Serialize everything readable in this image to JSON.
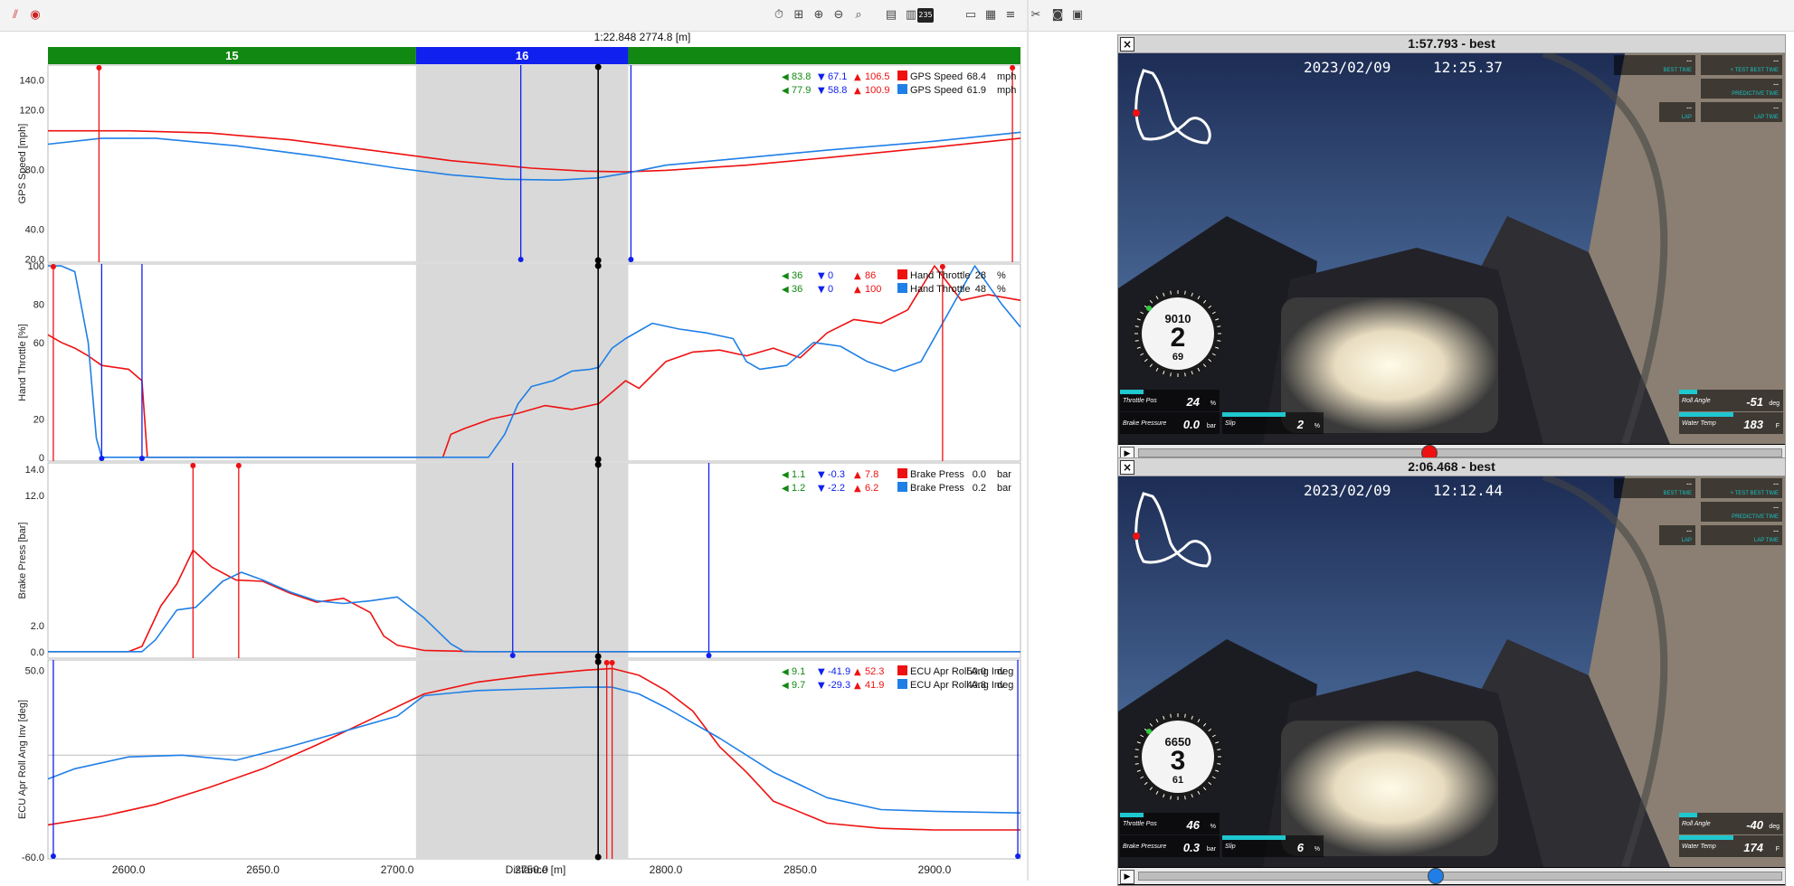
{
  "cursor_readout": "1:22.848  2774.8 [m]",
  "toolbar": {
    "badge_label": "235"
  },
  "colors": {
    "lap_red": "#ee1111",
    "lap_blue": "#1f7fe6",
    "sector_green": "#118811",
    "sector_blue": "#1020ee",
    "highlight_gray": "#d9d9d9",
    "hud_cyan": "#1fc7cf"
  },
  "sectors": [
    {
      "label": "15",
      "start": 2570,
      "end": 2707,
      "color": "#118811"
    },
    {
      "label": "16",
      "start": 2707,
      "end": 2786,
      "color": "#1020ee"
    },
    {
      "label": "",
      "start": 2786,
      "end": 2932,
      "color": "#118811"
    }
  ],
  "highlight": {
    "start": 2707,
    "end": 2786
  },
  "cursor_distance": 2774.8,
  "chart_data": {
    "type": "line",
    "xlabel": "Distance [m]",
    "xlim": [
      2570,
      2932
    ],
    "xticks": [
      2600,
      2650,
      2700,
      2750,
      2800,
      2850,
      2900
    ],
    "xtick_labels": [
      "2600.0",
      "2650.0",
      "2700.0",
      "2750.0",
      "2800.0",
      "2850.0",
      "2900.0"
    ],
    "panels": [
      {
        "ylabel": "GPS Speed [mph]",
        "ylim": [
          18,
          150
        ],
        "yticks": [
          20,
          40,
          80,
          120,
          140
        ],
        "ytick_labels": [
          "20.0",
          "40.0",
          "80.0",
          "120.0",
          "140.0"
        ],
        "series": [
          {
            "name": "GPS Speed",
            "color": "#ee1111",
            "x": [
              2570,
              2600,
              2630,
              2660,
              2690,
              2720,
              2750,
              2770,
              2785,
              2800,
              2830,
              2860,
              2900,
              2932
            ],
            "y": [
              106,
              106,
              104.5,
              100,
              93,
              86,
              81,
              79,
              78.5,
              79.5,
              83,
              88,
              95,
              101
            ]
          },
          {
            "name": "GPS Speed",
            "color": "#1f7fe6",
            "x": [
              2570,
              2590,
              2610,
              2640,
              2670,
              2700,
              2720,
              2740,
              2760,
              2775,
              2785,
              2800,
              2830,
              2860,
              2900,
              2932
            ],
            "y": [
              97,
              101,
              101,
              96,
              89,
              81,
              76.5,
              73.5,
              73,
              74.5,
              77.5,
              83,
              88,
              93,
              99,
              105
            ]
          }
        ],
        "legend": [
          {
            "min": "83.8",
            "mean": "67.1",
            "max": "106.5",
            "name": "GPS Speed",
            "value": "68.4",
            "unit": "mph",
            "color": "#ee1111"
          },
          {
            "min": "77.9",
            "mean": "58.8",
            "max": "100.9",
            "name": "GPS Speed",
            "value": "61.9",
            "unit": "mph",
            "color": "#1f7fe6"
          }
        ],
        "markers": [
          {
            "x": 2589,
            "color": "#ee1111",
            "cap": "top"
          },
          {
            "x": 2929,
            "color": "#ee1111",
            "cap": "top"
          },
          {
            "x": 2746,
            "color": "#1020ee",
            "cap": "bottom"
          },
          {
            "x": 2787,
            "color": "#1020ee",
            "cap": "bottom"
          }
        ]
      },
      {
        "ylabel": "Hand Throttle [%]",
        "ylim": [
          -2,
          101
        ],
        "yticks": [
          0,
          20,
          60,
          80,
          100
        ],
        "ytick_labels": [
          "0",
          "20",
          "60",
          "80",
          "100"
        ],
        "series": [
          {
            "name": "Hand Throttle",
            "color": "#ee1111",
            "x": [
              2570,
              2575,
              2580,
              2585,
              2590,
              2600,
              2605,
              2607,
              2609,
              2650,
              2700,
              2717,
              2720,
              2725,
              2735,
              2745,
              2755,
              2765,
              2775,
              2785,
              2790,
              2800,
              2810,
              2820,
              2830,
              2840,
              2850,
              2860,
              2870,
              2880,
              2890,
              2900,
              2910,
              2920,
              2932
            ],
            "y": [
              64,
              60,
              57,
              53,
              48,
              46,
              40,
              0,
              0,
              0,
              0,
              0,
              12,
              15,
              20,
              23,
              27,
              25,
              28,
              40,
              36,
              50,
              55,
              56,
              53,
              57,
              52,
              65,
              72,
              70,
              77,
              100,
              82,
              85,
              82
            ]
          },
          {
            "name": "Hand Throttle",
            "color": "#1f7fe6",
            "x": [
              2570,
              2575,
              2580,
              2585,
              2588,
              2590,
              2650,
              2700,
              2734,
              2740,
              2745,
              2750,
              2758,
              2765,
              2772,
              2775,
              2780,
              2785,
              2795,
              2805,
              2815,
              2825,
              2830,
              2835,
              2845,
              2855,
              2865,
              2875,
              2885,
              2895,
              2905,
              2915,
              2925,
              2932
            ],
            "y": [
              100,
              100,
              97,
              60,
              10,
              0,
              0,
              0,
              0,
              12,
              28,
              37,
              40,
              45,
              46,
              47,
              57,
              62,
              70,
              67,
              65,
              62,
              50,
              46,
              48,
              60,
              58,
              50,
              45,
              50,
              75,
              100,
              80,
              68
            ]
          }
        ],
        "legend": [
          {
            "min": "36",
            "mean": "0",
            "max": "86",
            "name": "Hand Throttle",
            "value": "28",
            "unit": "%",
            "color": "#ee1111"
          },
          {
            "min": "36",
            "mean": "0",
            "max": "100",
            "name": "Hand Throttle",
            "value": "48",
            "unit": "%",
            "color": "#1f7fe6"
          }
        ],
        "markers": [
          {
            "x": 2572,
            "color": "#ee1111",
            "cap": "top"
          },
          {
            "x": 2903,
            "color": "#ee1111",
            "cap": "top"
          },
          {
            "x": 2590,
            "color": "#1020ee",
            "cap": "bottom"
          },
          {
            "x": 2605,
            "color": "#1020ee",
            "cap": "bottom"
          }
        ]
      },
      {
        "ylabel": "Brake Press [bar]",
        "ylim": [
          -0.5,
          14.5
        ],
        "yticks": [
          0,
          2,
          12,
          14
        ],
        "ytick_labels": [
          "0.0",
          "2.0",
          "12.0",
          "14.0"
        ],
        "series": [
          {
            "name": "Brake Press",
            "color": "#ee1111",
            "x": [
              2570,
              2600,
              2605,
              2612,
              2618,
              2624,
              2631,
              2640,
              2650,
              2660,
              2670,
              2680,
              2690,
              2695,
              2700,
              2710,
              2730,
              2760,
              2800,
              2850,
              2932
            ],
            "y": [
              0,
              0,
              0.4,
              3.5,
              5.2,
              7.8,
              6.5,
              5.5,
              5.4,
              4.5,
              3.8,
              4.1,
              3,
              1.2,
              0.5,
              0.1,
              0,
              0,
              0,
              0,
              0
            ]
          },
          {
            "name": "Brake Press",
            "color": "#1f7fe6",
            "x": [
              2570,
              2605,
              2610,
              2618,
              2625,
              2635,
              2642,
              2650,
              2660,
              2670,
              2680,
              2690,
              2700,
              2710,
              2720,
              2725,
              2735,
              2760,
              2800,
              2850,
              2932
            ],
            "y": [
              0,
              0,
              0.9,
              3.2,
              3.4,
              5.4,
              6.1,
              5.5,
              4.6,
              3.9,
              3.7,
              3.9,
              4.2,
              2.6,
              0.6,
              0,
              0,
              0,
              0,
              0,
              0
            ]
          }
        ],
        "legend": [
          {
            "min": "1.1",
            "mean": "-0.3",
            "max": "7.8",
            "name": "Brake Press",
            "value": "0.0",
            "unit": "bar",
            "color": "#ee1111"
          },
          {
            "min": "1.2",
            "mean": "-2.2",
            "max": "6.2",
            "name": "Brake Press",
            "value": "0.2",
            "unit": "bar",
            "color": "#1f7fe6"
          }
        ],
        "markers": [
          {
            "x": 2624,
            "color": "#ee1111",
            "cap": "top"
          },
          {
            "x": 2641,
            "color": "#ee1111",
            "cap": "top"
          },
          {
            "x": 2743,
            "color": "#1020ee",
            "cap": "bottom"
          },
          {
            "x": 2816,
            "color": "#1020ee",
            "cap": "bottom"
          }
        ]
      },
      {
        "ylabel": "ECU Apr Roll Ang Inv [deg]",
        "ylim": [
          -61,
          56
        ],
        "yticks": [
          -60,
          50
        ],
        "ytick_labels": [
          "-60.0",
          "50.0"
        ],
        "zero_line": 0,
        "series": [
          {
            "name": "ECU Apr Roll Ang Inv",
            "color": "#ee1111",
            "x": [
              2570,
              2590,
              2610,
              2630,
              2650,
              2670,
              2690,
              2710,
              2730,
              2750,
              2770,
              2780,
              2790,
              2800,
              2810,
              2820,
              2830,
              2840,
              2860,
              2880,
              2900,
              2932
            ],
            "y": [
              -41,
              -36,
              -29,
              -19,
              -8,
              6,
              21,
              36,
              43,
              47,
              50,
              51,
              47,
              38,
              26,
              5,
              -10,
              -27,
              -40,
              -43,
              -44,
              -44
            ]
          },
          {
            "name": "ECU Apr Roll Ang Inv",
            "color": "#1f7fe6",
            "x": [
              2570,
              2580,
              2600,
              2620,
              2640,
              2660,
              2680,
              2700,
              2710,
              2730,
              2750,
              2770,
              2780,
              2790,
              2800,
              2820,
              2840,
              2860,
              2880,
              2900,
              2932
            ],
            "y": [
              -14,
              -8,
              -1,
              0,
              -3,
              5,
              14,
              23,
              35,
              38,
              39,
              40,
              40,
              36,
              28,
              10,
              -10,
              -25,
              -32,
              -33,
              -34
            ]
          }
        ],
        "legend": [
          {
            "min": "9.1",
            "mean": "-41.9",
            "max": "52.3",
            "name": "ECU Apr Roll Ang Inv",
            "value": "50.0",
            "unit": "deg",
            "color": "#ee1111"
          },
          {
            "min": "9.7",
            "mean": "-29.3",
            "max": "41.9",
            "name": "ECU Apr Roll Ang Inv",
            "value": "40.8",
            "unit": "deg",
            "color": "#1f7fe6"
          }
        ],
        "markers": [
          {
            "x": 2778,
            "color": "#ee1111",
            "cap": "top"
          },
          {
            "x": 2780,
            "color": "#ee1111",
            "cap": "top"
          },
          {
            "x": 2572,
            "color": "#1020ee",
            "cap": "bottom"
          },
          {
            "x": 2931,
            "color": "#1020ee",
            "cap": "bottom"
          }
        ]
      }
    ]
  },
  "videos": [
    {
      "title": "1:57.793 - best",
      "date": "2023/02/09",
      "time": "12:25.37",
      "timing": [
        {
          "value": "--",
          "label": "BEST TIME"
        },
        {
          "value": "--",
          "label": "+ TEST BEST TIME"
        },
        {
          "value": "--",
          "label": "PREDICTIVE TIME"
        },
        {
          "value": "--",
          "label": "LAP"
        },
        {
          "value": "--",
          "label": "LAP TIME"
        }
      ],
      "gauge": {
        "rpm": "9010",
        "gear": "2",
        "speed": "69"
      },
      "hud": {
        "throttle": {
          "label": "Throttle Pos",
          "value": "24",
          "unit": "%"
        },
        "brake": {
          "label": "Brake Pressure",
          "value": "0.0",
          "unit": "bar"
        },
        "slip": {
          "label": "Slip",
          "value": "2",
          "unit": "%"
        },
        "roll": {
          "label": "Roll Angle",
          "value": "-51",
          "unit": "deg"
        },
        "water": {
          "label": "Water Temp",
          "value": "183",
          "unit": "F"
        }
      },
      "progress": 0.45,
      "thumb_color": "#ee1111"
    },
    {
      "title": "2:06.468 - best",
      "date": "2023/02/09",
      "time": "12:12.44",
      "timing": [
        {
          "value": "--",
          "label": "BEST TIME"
        },
        {
          "value": "--",
          "label": "+ TEST BEST TIME"
        },
        {
          "value": "--",
          "label": "PREDICTIVE TIME"
        },
        {
          "value": "--",
          "label": "LAP"
        },
        {
          "value": "--",
          "label": "LAP TIME"
        }
      ],
      "gauge": {
        "rpm": "6650",
        "gear": "3",
        "speed": "61"
      },
      "hud": {
        "throttle": {
          "label": "Throttle Pos",
          "value": "46",
          "unit": "%"
        },
        "brake": {
          "label": "Brake Pressure",
          "value": "0.3",
          "unit": "bar"
        },
        "slip": {
          "label": "Slip",
          "value": "6",
          "unit": "%"
        },
        "roll": {
          "label": "Roll Angle",
          "value": "-40",
          "unit": "deg"
        },
        "water": {
          "label": "Water Temp",
          "value": "174",
          "unit": "F"
        }
      },
      "progress": 0.46,
      "thumb_color": "#1f7fe6"
    }
  ]
}
